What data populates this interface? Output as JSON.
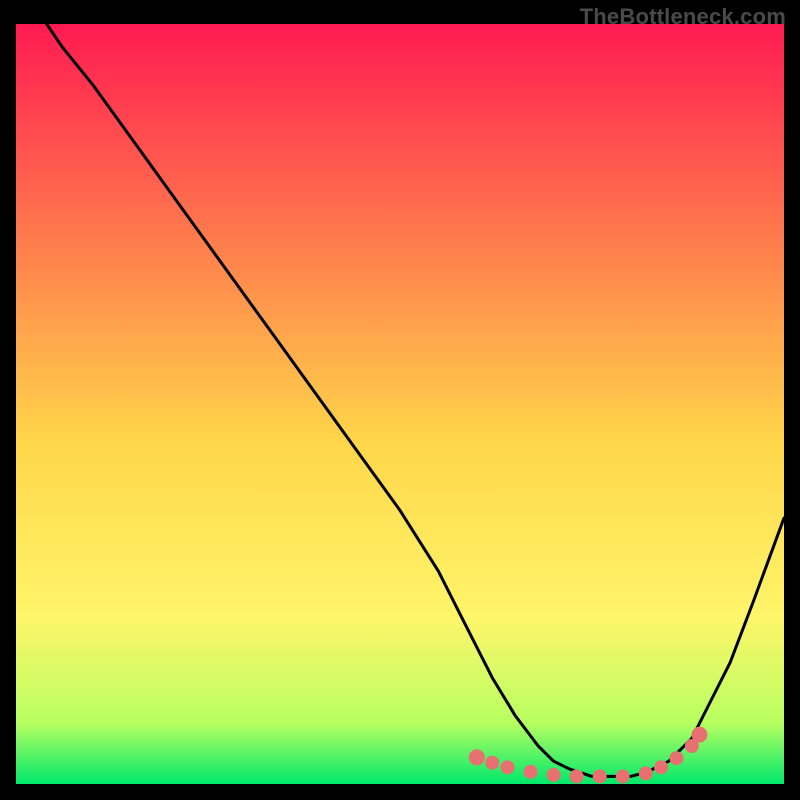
{
  "watermark": "TheBottleneck.com",
  "colors": {
    "background": "#000000",
    "gradient_top": "#ff1a52",
    "gradient_mid_upper": "#ff7a4d",
    "gradient_mid": "#ffd64a",
    "gradient_mid_lower": "#fff56a",
    "gradient_lower": "#b7ff60",
    "gradient_bottom": "#00e86b",
    "curve": "#000000",
    "markers": "#e87070"
  },
  "chart_data": {
    "type": "line",
    "title": "",
    "xlabel": "",
    "ylabel": "",
    "xlim": [
      0,
      100
    ],
    "ylim": [
      0,
      100
    ],
    "series": [
      {
        "name": "bottleneck-curve",
        "x": [
          4,
          6,
          10,
          15,
          20,
          25,
          30,
          35,
          40,
          45,
          50,
          55,
          58,
          60,
          62,
          65,
          68,
          70,
          72,
          75,
          78,
          80,
          82,
          85,
          88,
          90,
          93,
          96,
          100
        ],
        "y": [
          100,
          97,
          92,
          85,
          78,
          71,
          64,
          57,
          50,
          43,
          36,
          28,
          22,
          18,
          14,
          9,
          5,
          3,
          2,
          1,
          1,
          1,
          1.5,
          3,
          6,
          10,
          16,
          24,
          35
        ]
      }
    ],
    "markers": {
      "name": "highlight-points",
      "x": [
        60,
        62,
        64,
        67,
        70,
        73,
        76,
        79,
        82,
        84,
        86,
        88,
        89
      ],
      "y": [
        3.5,
        2.8,
        2.2,
        1.6,
        1.2,
        1.0,
        1.0,
        1.0,
        1.4,
        2.2,
        3.4,
        5.0,
        6.5
      ]
    }
  }
}
